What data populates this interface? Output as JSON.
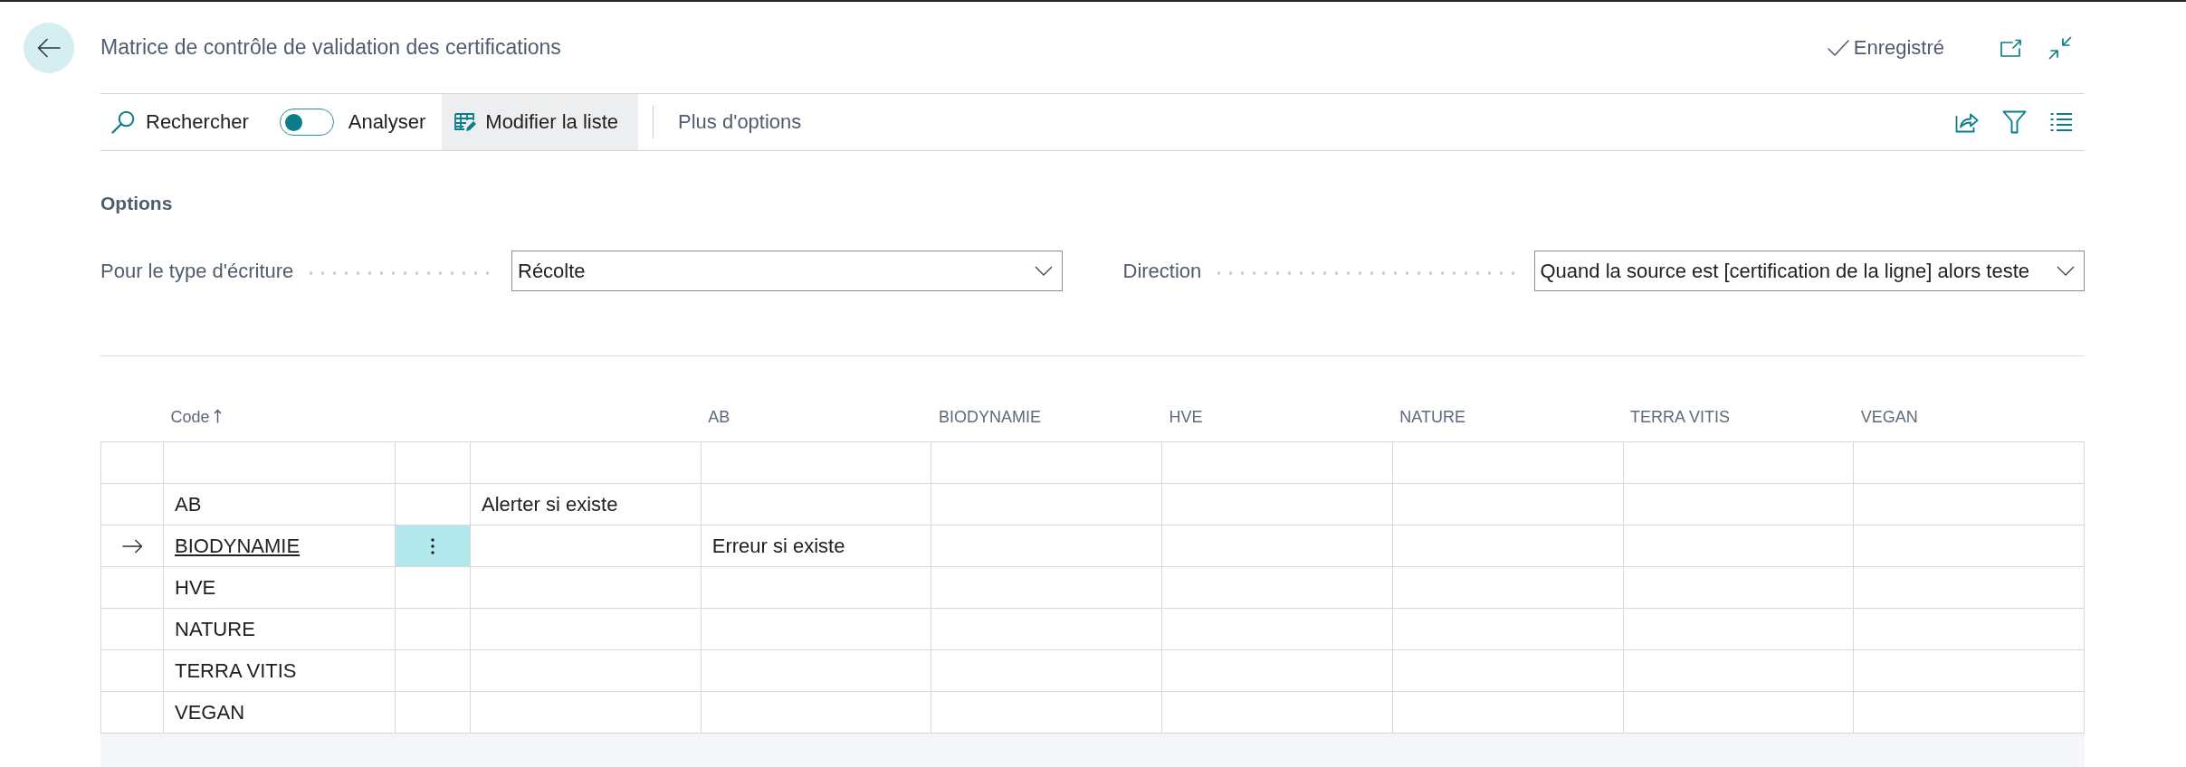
{
  "page": {
    "title": "Matrice de contrôle de validation des certifications",
    "status": "Enregistré"
  },
  "toolbar": {
    "actions": [
      {
        "kind": "search",
        "label": "Rechercher",
        "highlighted": false
      },
      {
        "kind": "toggle",
        "label": "Analyser",
        "on": false,
        "highlighted": false
      },
      {
        "kind": "edit-list",
        "label": "Modifier la liste",
        "highlighted": true
      },
      {
        "kind": "more",
        "label": "Plus d'options",
        "highlighted": false
      }
    ]
  },
  "options": {
    "heading": "Options",
    "fields": [
      {
        "label": "Pour le type d'écriture",
        "value": "Récolte"
      },
      {
        "label": "Direction",
        "value": "Quand la source est [certification de la ligne] alors teste"
      }
    ]
  },
  "table": {
    "columns": [
      {
        "kind": "marker"
      },
      {
        "kind": "code",
        "heading": "Code",
        "sorted": true
      },
      {
        "kind": "menu"
      },
      {
        "kind": "value"
      },
      {
        "kind": "value",
        "heading": "AB"
      },
      {
        "kind": "value",
        "heading": "BIODYNAMIE"
      },
      {
        "kind": "value",
        "heading": "HVE"
      },
      {
        "kind": "value",
        "heading": "NATURE"
      },
      {
        "kind": "value",
        "heading": "TERRA VITIS"
      },
      {
        "kind": "value",
        "heading": "VEGAN"
      }
    ],
    "rows": [
      {
        "selected": false,
        "cells": [
          "",
          "",
          "",
          "",
          "",
          "",
          "",
          "",
          "",
          ""
        ]
      },
      {
        "selected": false,
        "cells": [
          "",
          "AB",
          "",
          "Alerter si existe",
          "",
          "",
          "",
          "",
          "",
          ""
        ]
      },
      {
        "selected": true,
        "cells": [
          "",
          "BIODYNAMIE",
          "",
          "",
          "Erreur si existe",
          "",
          "",
          "",
          "",
          ""
        ]
      },
      {
        "selected": false,
        "cells": [
          "",
          "HVE",
          "",
          "",
          "",
          "",
          "",
          "",
          "",
          ""
        ]
      },
      {
        "selected": false,
        "cells": [
          "",
          "NATURE",
          "",
          "",
          "",
          "",
          "",
          "",
          "",
          ""
        ]
      },
      {
        "selected": false,
        "cells": [
          "",
          "TERRA VITIS",
          "",
          "",
          "",
          "",
          "",
          "",
          "",
          ""
        ]
      },
      {
        "selected": false,
        "cells": [
          "",
          "VEGAN",
          "",
          "",
          "",
          "",
          "",
          "",
          "",
          ""
        ]
      }
    ]
  }
}
